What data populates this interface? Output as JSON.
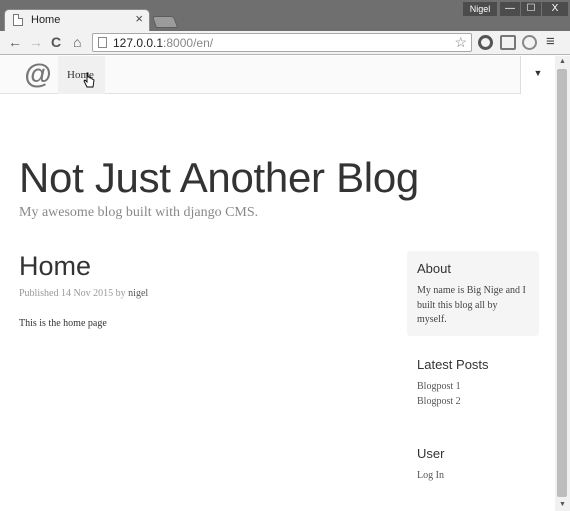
{
  "browser": {
    "tab_title": "Home",
    "tab_close": "×",
    "user_name": "Nigel",
    "window_controls": {
      "minimize": "—",
      "maximize": "☐",
      "close": "X"
    },
    "nav": {
      "back": "←",
      "forward": "→",
      "reload": "C",
      "home": "⌂"
    },
    "address": {
      "host": "127.0.0.1",
      "path": ":8000/en/"
    },
    "star": "☆",
    "menu": "≡"
  },
  "cms_toolbar": {
    "logo": "@",
    "menu_label": "Home",
    "dropdown_arrow": "▼"
  },
  "site": {
    "title": "Not Just Another Blog",
    "tagline": "My awesome blog built with django CMS."
  },
  "post": {
    "title": "Home",
    "meta_prefix": "Published 14 Nov 2015 by ",
    "author": "nigel",
    "body": "This is the home page"
  },
  "sidebar": {
    "about_heading": "About",
    "about_text": "My name is Big Nige and I built this blog all by myself.",
    "latest_heading": "Latest Posts",
    "latest_posts": [
      "Blogpost 1",
      "Blogpost 2"
    ],
    "user_heading": "User",
    "login_link": "Log In"
  },
  "scrollbar": {
    "up": "▲",
    "down": "▼"
  }
}
